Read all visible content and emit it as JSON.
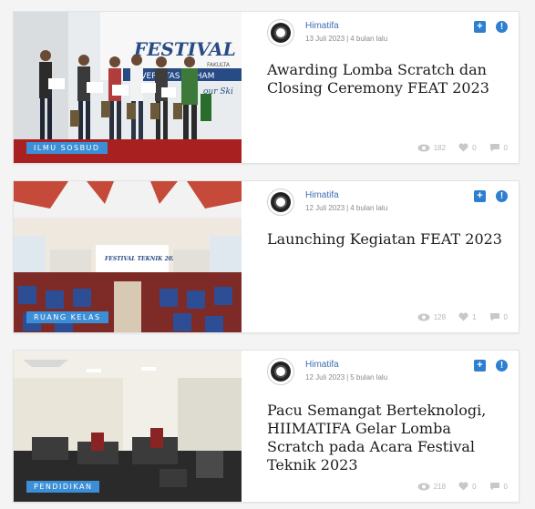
{
  "posts": [
    {
      "category": "ILMU SOSBUD",
      "author": "Himatifa",
      "date": "13 Juli 2023",
      "ago": "4 bulan lalu",
      "title": "Awarding Lomba Scratch dan Closing Ceremony FEAT 2023",
      "views": "182",
      "likes": "0",
      "comments": "0",
      "banner_text": "FESTIVAL TE",
      "banner_sub": "FAKULTA",
      "banner_sub2": "NIVERSITAS MUHAM",
      "banner_tag": "our Ski"
    },
    {
      "category": "RUANG KELAS",
      "author": "Himatifa",
      "date": "12 Juli 2023",
      "ago": "4 bulan lalu",
      "title": "Launching Kegiatan FEAT 2023",
      "views": "128",
      "likes": "1",
      "comments": "0",
      "banner_text": "FESTIVAL TEKNIK 2023"
    },
    {
      "category": "PENDIDIKAN",
      "author": "Himatifa",
      "date": "12 Juli 2023",
      "ago": "5 bulan lalu",
      "title": "Pacu Semangat Berteknologi, HIIMATIFA Gelar Lomba Scratch pada Acara Festival Teknik 2023",
      "views": "218",
      "likes": "0",
      "comments": "0"
    }
  ],
  "icons": {
    "eye": "eye-icon",
    "heart": "heart-icon",
    "comment": "comment-icon",
    "plus": "plus-icon",
    "alert": "alert-icon"
  },
  "colors": {
    "accent": "#2e7fd0",
    "badge": "#3c8fd6",
    "author": "#3c6fb0"
  }
}
